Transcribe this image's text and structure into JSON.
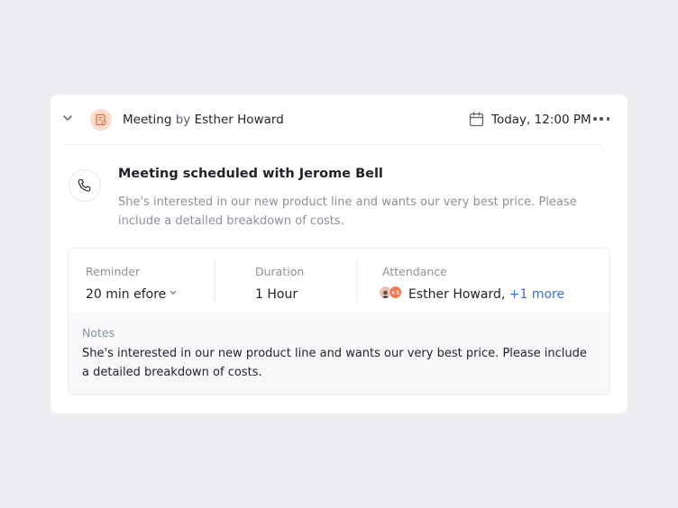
{
  "header": {
    "activity_type": "Meeting",
    "by_text": "by",
    "author": "Esther Howard",
    "datetime": "Today, 12:00 PM",
    "icons": {
      "collapse": "chevron-down-icon",
      "type": "meeting-note-icon",
      "calendar": "calendar-icon",
      "more": "more-horizontal-icon"
    }
  },
  "activity": {
    "icon": "phone-icon",
    "title": "Meeting scheduled with Jerome Bell",
    "description": "She's interested in our new product line and wants our very best price. Please include a detailed breakdown of costs."
  },
  "details": {
    "reminder": {
      "label": "Reminder",
      "value": "20 min efore"
    },
    "duration": {
      "label": "Duration",
      "value": "1 Hour"
    },
    "attendance": {
      "label": "Attendance",
      "avatar_extra": "+1",
      "name": "Esther Howard,",
      "more_link": "+1 more"
    }
  },
  "notes": {
    "label": "Notes",
    "body": "She's interested in our new product line and wants our very best price. Please include a detailed breakdown of costs."
  },
  "colors": {
    "background": "#eceef2",
    "card": "#ffffff",
    "accent_orange": "#f07b52",
    "type_icon_bg": "#fbdccd",
    "link_blue": "#3b6fd4",
    "muted_text": "#8b909a"
  }
}
